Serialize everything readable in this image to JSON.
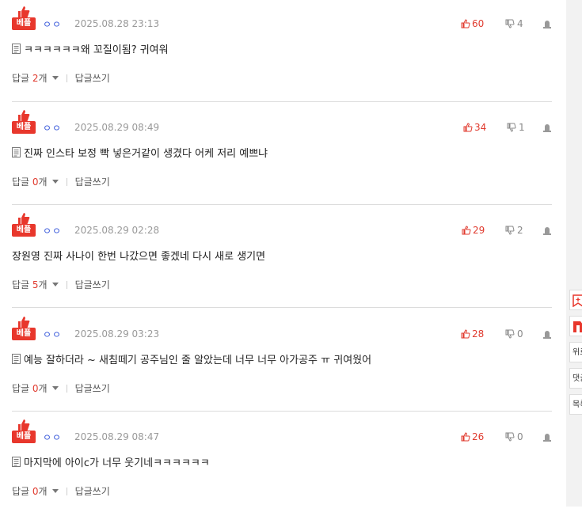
{
  "comments": [
    {
      "badge": "베플",
      "nick": "ㅇㅇ",
      "date": "2025.08.28 23:13",
      "up": "60",
      "down": "4",
      "text": "ㅋㅋㅋㅋㅋㅋ왜 꼬질이됨? 귀여워",
      "has_doc": true,
      "reply_prefix": "답글 ",
      "reply_count": "2",
      "reply_suffix": "개",
      "write": "답글쓰기"
    },
    {
      "badge": "베플",
      "nick": "ㅇㅇ",
      "date": "2025.08.29 08:49",
      "up": "34",
      "down": "1",
      "text": "진짜 인스타 보정 빡 넣은거같이 생겼다 어케 저리 예쁘냐",
      "has_doc": true,
      "reply_prefix": "답글 ",
      "reply_count": "0",
      "reply_suffix": "개",
      "write": "답글쓰기"
    },
    {
      "badge": "베플",
      "nick": "ㅇㅇ",
      "date": "2025.08.29 02:28",
      "up": "29",
      "down": "2",
      "text": "장원영 진짜 사나이 한번 나갔으면 좋겠네 다시 새로 생기면",
      "has_doc": false,
      "reply_prefix": "답글 ",
      "reply_count": "5",
      "reply_suffix": "개",
      "write": "답글쓰기"
    },
    {
      "badge": "베플",
      "nick": "ㅇㅇ",
      "date": "2025.08.29 03:23",
      "up": "28",
      "down": "0",
      "text": "예능 잘하더라 ~ 새침떼기 공주님인 줄 알았는데 너무 너무 아가공주 ㅠ 귀여웠어",
      "has_doc": true,
      "reply_prefix": "답글 ",
      "reply_count": "0",
      "reply_suffix": "개",
      "write": "답글쓰기"
    },
    {
      "badge": "베플",
      "nick": "ㅇㅇ",
      "date": "2025.08.29 08:47",
      "up": "26",
      "down": "0",
      "text": "마지막에 아이c가 너무 웃기네ㅋㅋㅋㅋㅋㅋ",
      "has_doc": true,
      "reply_prefix": "답글 ",
      "reply_count": "0",
      "reply_suffix": "개",
      "write": "답글쓰기"
    }
  ],
  "side_buttons": [
    {
      "label": "",
      "icon": "bookmark-icon"
    },
    {
      "label": "",
      "icon": "logo-icon"
    },
    {
      "label": "위로"
    },
    {
      "label": "댓글"
    },
    {
      "label": "목록"
    }
  ],
  "colors": {
    "accent": "#e8372c",
    "up": "#e03a2e",
    "nick": "#3b5bdb"
  }
}
